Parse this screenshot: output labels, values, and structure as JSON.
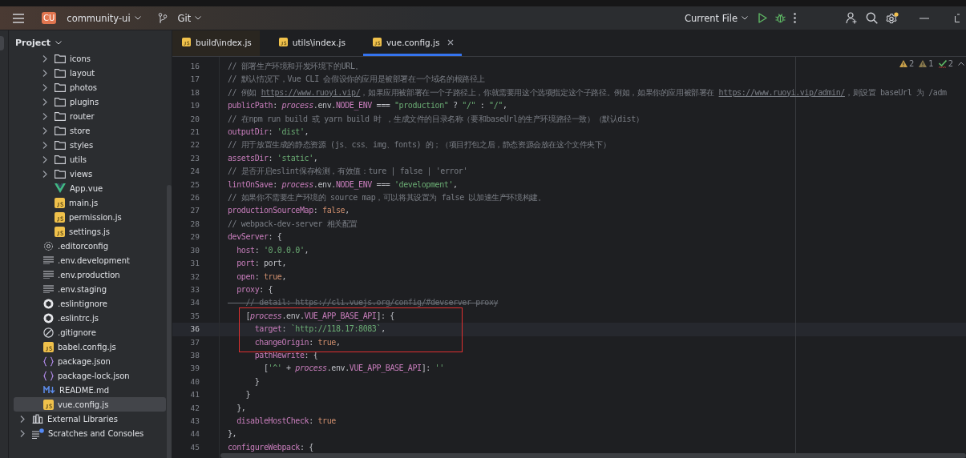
{
  "toolbar": {
    "project": {
      "badge": "CU",
      "name": "community-ui"
    },
    "vcs": "Git",
    "run_config": "Current File"
  },
  "sidebar": {
    "title": "Project",
    "tree": [
      {
        "children": [
          {
            "children": [
              {
                "label": "icons",
                "kind": "folder",
                "expanded": false,
                "selected": false
              },
              {
                "label": "layout",
                "kind": "folder",
                "expanded": false,
                "selected": false
              },
              {
                "label": "photos",
                "kind": "folder",
                "expanded": false,
                "selected": false
              },
              {
                "label": "plugins",
                "kind": "folder",
                "expanded": false,
                "selected": false
              },
              {
                "label": "router",
                "kind": "folder",
                "expanded": false,
                "selected": false
              },
              {
                "label": "store",
                "kind": "folder",
                "expanded": false,
                "selected": false
              },
              {
                "label": "styles",
                "kind": "folder",
                "expanded": false,
                "selected": false
              },
              {
                "label": "utils",
                "kind": "folder",
                "expanded": false,
                "selected": false
              },
              {
                "label": "views",
                "kind": "folder",
                "expanded": false,
                "selected": false
              },
              {
                "label": "App.vue",
                "kind": "vue",
                "selected": false
              },
              {
                "label": "main.js",
                "kind": "js",
                "selected": false
              },
              {
                "label": "permission.js",
                "kind": "js",
                "selected": false
              },
              {
                "label": "settings.js",
                "kind": "js",
                "selected": false
              }
            ]
          },
          {
            "label": ".editorconfig",
            "kind": "gear",
            "selected": false
          },
          {
            "label": ".env.development",
            "kind": "text",
            "selected": false
          },
          {
            "label": ".env.production",
            "kind": "text",
            "selected": false
          },
          {
            "label": ".env.staging",
            "kind": "text",
            "selected": false
          },
          {
            "label": ".eslintignore",
            "kind": "eslint",
            "selected": false
          },
          {
            "label": ".eslintrc.js",
            "kind": "eslint",
            "selected": false
          },
          {
            "label": ".gitignore",
            "kind": "ignore",
            "selected": false
          },
          {
            "label": "babel.config.js",
            "kind": "js",
            "selected": false
          },
          {
            "label": "package.json",
            "kind": "json",
            "selected": false
          },
          {
            "label": "package-lock.json",
            "kind": "json",
            "selected": false
          },
          {
            "label": "README.md",
            "kind": "md",
            "selected": false
          },
          {
            "label": "vue.config.js",
            "kind": "js",
            "selected": true
          }
        ]
      },
      {
        "label": "External Libraries",
        "kind": "library",
        "expanded": false,
        "selected": false
      },
      {
        "label": "Scratches and Consoles",
        "kind": "scratches",
        "expanded": false,
        "selected": false
      }
    ]
  },
  "tabs": [
    {
      "label": "build\\index.js",
      "selected": false,
      "closable": false
    },
    {
      "label": "utils\\index.js",
      "selected": false,
      "closable": false
    },
    {
      "label": "vue.config.js",
      "selected": true,
      "closable": true
    }
  ],
  "inspections": [
    {
      "kind": "warning",
      "count": "2"
    },
    {
      "kind": "weak",
      "count": "1"
    },
    {
      "kind": "typo",
      "count": "2"
    }
  ],
  "editor": {
    "lines": [
      {
        "number": "16",
        "current": false,
        "framed": false,
        "tokens": [
          {
            "kind": "comment",
            "t": "// 部署生产环境和开发环境下的URL。"
          }
        ]
      },
      {
        "number": "17",
        "current": false,
        "framed": false,
        "tokens": [
          {
            "kind": "comment",
            "t": "// 默认情况下，Vue CLI 会假设你的应用是被部署在一个域名的根路径上"
          }
        ]
      },
      {
        "number": "18",
        "current": false,
        "framed": false,
        "tokens": [
          {
            "kind": "comment",
            "t": "// 例如 "
          },
          {
            "kind": "link",
            "t": "https://www.ruoyi.vip/"
          },
          {
            "kind": "comment",
            "t": "，如果应用被部署在一个子路径上，你就需要用这个选项指定这个子路径。例如，如果你的应用被部署在 "
          },
          {
            "kind": "link",
            "t": "https://www.ruoyi.vip/admin/"
          },
          {
            "kind": "comment",
            "t": "，则设置 baseUrl 为 /adm"
          }
        ]
      },
      {
        "number": "19",
        "current": false,
        "framed": false,
        "tokens": [
          {
            "kind": "key",
            "t": "publicPath"
          },
          {
            "kind": "plain",
            "t": ": "
          },
          {
            "kind": "global",
            "t": "process"
          },
          {
            "kind": "plain",
            "t": ".env."
          },
          {
            "kind": "prop",
            "t": "NODE_ENV"
          },
          {
            "kind": "plain",
            "t": " === "
          },
          {
            "kind": "string",
            "t": "\"production\""
          },
          {
            "kind": "plain",
            "t": " ? "
          },
          {
            "kind": "string",
            "t": "\"/\""
          },
          {
            "kind": "plain",
            "t": " : "
          },
          {
            "kind": "string",
            "t": "\"/\""
          },
          {
            "kind": "plain",
            "t": ","
          }
        ]
      },
      {
        "number": "20",
        "current": false,
        "framed": false,
        "tokens": [
          {
            "kind": "comment",
            "t": "// 在npm run build 或 yarn build 时 ，生成文件的目录名称（要和baseUrl的生产环境路径一致）（默认dist）"
          }
        ]
      },
      {
        "number": "21",
        "current": false,
        "framed": false,
        "tokens": [
          {
            "kind": "key",
            "t": "outputDir"
          },
          {
            "kind": "plain",
            "t": ": "
          },
          {
            "kind": "string",
            "t": "'dist'"
          },
          {
            "kind": "plain",
            "t": ","
          }
        ]
      },
      {
        "number": "22",
        "current": false,
        "framed": false,
        "tokens": [
          {
            "kind": "comment",
            "t": "// 用于放置生成的静态资源 (js、css、img、fonts) 的；（项目打包之后，静态资源会放在这个文件夹下）"
          }
        ]
      },
      {
        "number": "23",
        "current": false,
        "framed": false,
        "tokens": [
          {
            "kind": "key",
            "t": "assetsDir"
          },
          {
            "kind": "plain",
            "t": ": "
          },
          {
            "kind": "string",
            "t": "'static'"
          },
          {
            "kind": "plain",
            "t": ","
          }
        ]
      },
      {
        "number": "24",
        "current": false,
        "framed": false,
        "tokens": [
          {
            "kind": "comment",
            "t": "// 是否开启eslint保存检测，有效值：ture | false | 'error'"
          }
        ]
      },
      {
        "number": "25",
        "current": false,
        "framed": false,
        "tokens": [
          {
            "kind": "key",
            "t": "lintOnSave"
          },
          {
            "kind": "plain",
            "t": ": "
          },
          {
            "kind": "global",
            "t": "process"
          },
          {
            "kind": "plain",
            "t": ".env."
          },
          {
            "kind": "prop",
            "t": "NODE_ENV"
          },
          {
            "kind": "plain",
            "t": " === "
          },
          {
            "kind": "string",
            "t": "'development'"
          },
          {
            "kind": "plain",
            "t": ","
          }
        ]
      },
      {
        "number": "26",
        "current": false,
        "framed": false,
        "tokens": [
          {
            "kind": "comment",
            "t": "// 如果你不需要生产环境的 source map，可以将其设置为 false 以加速生产环境构建。"
          }
        ]
      },
      {
        "number": "27",
        "current": false,
        "framed": false,
        "tokens": [
          {
            "kind": "key",
            "t": "productionSourceMap"
          },
          {
            "kind": "plain",
            "t": ": "
          },
          {
            "kind": "keyword",
            "t": "false"
          },
          {
            "kind": "plain",
            "t": ","
          }
        ]
      },
      {
        "number": "28",
        "current": false,
        "framed": false,
        "tokens": [
          {
            "kind": "comment",
            "t": "// webpack-dev-server 相关配置"
          }
        ]
      },
      {
        "number": "29",
        "current": false,
        "framed": false,
        "tokens": [
          {
            "kind": "key",
            "t": "devServer"
          },
          {
            "kind": "plain",
            "t": ": {"
          }
        ]
      },
      {
        "number": "30",
        "current": false,
        "framed": false,
        "tokens": [
          {
            "kind": "key",
            "t": "  host"
          },
          {
            "kind": "plain",
            "t": ": "
          },
          {
            "kind": "string",
            "t": "'0.0.0.0'"
          },
          {
            "kind": "plain",
            "t": ","
          }
        ]
      },
      {
        "number": "31",
        "current": false,
        "framed": false,
        "tokens": [
          {
            "kind": "key",
            "t": "  port"
          },
          {
            "kind": "plain",
            "t": ": port,"
          }
        ]
      },
      {
        "number": "32",
        "current": false,
        "framed": false,
        "tokens": [
          {
            "kind": "key",
            "t": "  open"
          },
          {
            "kind": "plain",
            "t": ": "
          },
          {
            "kind": "keyword",
            "t": "true"
          },
          {
            "kind": "plain",
            "t": ","
          }
        ]
      },
      {
        "number": "33",
        "current": false,
        "framed": false,
        "tokens": [
          {
            "kind": "key",
            "t": "  proxy"
          },
          {
            "kind": "plain",
            "t": ": {"
          }
        ]
      },
      {
        "number": "34",
        "current": false,
        "framed": false,
        "tokens": [
          {
            "kind": "dead",
            "t": "    // detail: https://cli.vuejs.org/config/#devserver-proxy"
          }
        ]
      },
      {
        "number": "35",
        "current": false,
        "framed": true,
        "tokens": [
          {
            "kind": "plain",
            "t": "    ["
          },
          {
            "kind": "global",
            "t": "process"
          },
          {
            "kind": "plain",
            "t": ".env."
          },
          {
            "kind": "prop",
            "t": "VUE_APP_BASE_API"
          },
          {
            "kind": "plain",
            "t": "]: {"
          }
        ]
      },
      {
        "number": "36",
        "current": true,
        "framed": true,
        "tokens": [
          {
            "kind": "key",
            "t": "      target"
          },
          {
            "kind": "plain",
            "t": ": "
          },
          {
            "kind": "string",
            "t": "`http://118.17:8083`"
          },
          {
            "kind": "plain",
            "t": ","
          }
        ]
      },
      {
        "number": "37",
        "current": false,
        "framed": true,
        "tokens": [
          {
            "kind": "key",
            "t": "      changeOrigin"
          },
          {
            "kind": "plain",
            "t": ": "
          },
          {
            "kind": "keyword",
            "t": "true"
          },
          {
            "kind": "plain",
            "t": ","
          }
        ]
      },
      {
        "number": "38",
        "current": false,
        "framed": false,
        "tokens": [
          {
            "kind": "key",
            "t": "      pathRewrite"
          },
          {
            "kind": "plain",
            "t": ": {"
          }
        ]
      },
      {
        "number": "39",
        "current": false,
        "framed": false,
        "tokens": [
          {
            "kind": "plain",
            "t": "        ["
          },
          {
            "kind": "string",
            "t": "'^'"
          },
          {
            "kind": "plain",
            "t": " + "
          },
          {
            "kind": "global",
            "t": "process"
          },
          {
            "kind": "plain",
            "t": ".env."
          },
          {
            "kind": "prop",
            "t": "VUE_APP_BASE_API"
          },
          {
            "kind": "plain",
            "t": "]: "
          },
          {
            "kind": "string",
            "t": "''"
          }
        ]
      },
      {
        "number": "40",
        "current": false,
        "framed": false,
        "tokens": [
          {
            "kind": "plain",
            "t": "      }"
          }
        ]
      },
      {
        "number": "41",
        "current": false,
        "framed": false,
        "tokens": [
          {
            "kind": "plain",
            "t": "    }"
          }
        ]
      },
      {
        "number": "42",
        "current": false,
        "framed": false,
        "tokens": [
          {
            "kind": "plain",
            "t": "  },"
          }
        ]
      },
      {
        "number": "43",
        "current": false,
        "framed": false,
        "tokens": [
          {
            "kind": "key",
            "t": "  disableHostCheck"
          },
          {
            "kind": "plain",
            "t": ": "
          },
          {
            "kind": "keyword",
            "t": "true"
          }
        ]
      },
      {
        "number": "44",
        "current": false,
        "framed": false,
        "tokens": [
          {
            "kind": "plain",
            "t": "},"
          }
        ]
      },
      {
        "number": "45",
        "current": false,
        "framed": false,
        "tokens": [
          {
            "kind": "key",
            "t": "configureWebpack"
          },
          {
            "kind": "plain",
            "t": ": {"
          }
        ]
      }
    ]
  }
}
